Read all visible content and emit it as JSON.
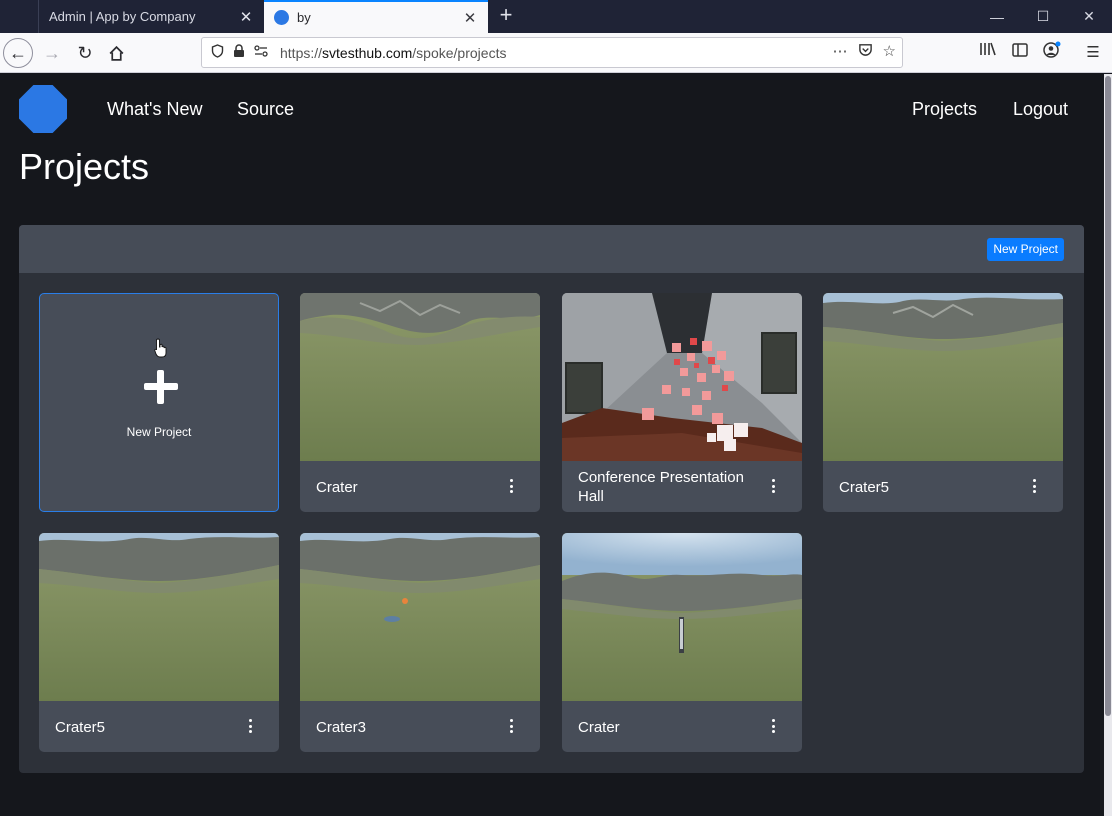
{
  "browser": {
    "tabs": [
      {
        "label": "Admin | App by Company",
        "active": false
      },
      {
        "label": "by",
        "active": true
      }
    ],
    "url_prefix": "https://",
    "url_host": "svtesthub.com",
    "url_path": "/spoke/projects"
  },
  "colors": {
    "accent": "#0a7cff",
    "logo": "#2b78e4",
    "page_bg": "#15171c",
    "panel_bg": "#2d3139",
    "card_bg": "#474d58"
  },
  "nav": {
    "whats_new": "What's New",
    "source": "Source",
    "projects": "Projects",
    "logout": "Logout"
  },
  "page": {
    "title": "Projects",
    "new_project_button": "New Project",
    "new_project_card_label": "New Project"
  },
  "projects": [
    {
      "name": "Crater",
      "thumbnail": "crater-landscape"
    },
    {
      "name": "Conference Presentation Hall",
      "thumbnail": "conference-room"
    },
    {
      "name": "Crater5",
      "thumbnail": "crater-landscape"
    },
    {
      "name": "Crater5",
      "thumbnail": "crater-landscape"
    },
    {
      "name": "Crater3",
      "thumbnail": "crater-landscape"
    },
    {
      "name": "Crater",
      "thumbnail": "crater-landscape"
    }
  ]
}
